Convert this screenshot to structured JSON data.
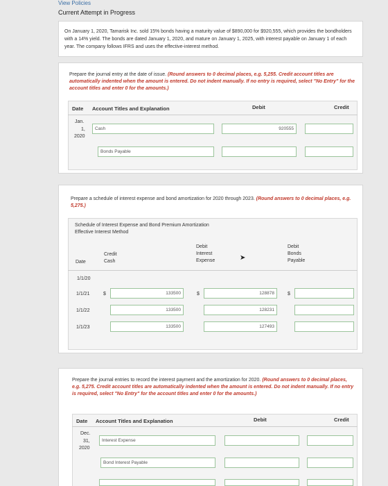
{
  "header": {
    "view_policies": "View Policies",
    "attempt": "Current Attempt in Progress"
  },
  "problem_text": "On January 1, 2020, Tamarisk Inc. sold 15% bonds having a maturity value of $890,000 for $920,555, which provides the bondholders with a 14% yield. The bonds are dated January 1, 2020, and mature on January 1, 2025, with interest payable on January 1 of each year. The company follows IFRS and uses the effective-interest method.",
  "part1": {
    "instruction_plain": "Prepare the journal entry at the date of issue.",
    "instruction_red": "(Round answers to 0 decimal places, e.g. 5,255. Credit account titles are automatically indented when the amount is entered. Do not indent manually. If no entry is required, select \"No Entry\" for the account titles and enter 0 for the amounts.)",
    "columns": {
      "date": "Date",
      "account": "Account Titles and Explanation",
      "debit": "Debit",
      "credit": "Credit"
    },
    "date_month": "Jan.",
    "date_day": "1,",
    "date_year": "2020",
    "rows": [
      {
        "account": "Cash",
        "debit": "920555",
        "credit": ""
      },
      {
        "account": "Bonds Payable",
        "debit": "",
        "credit": ""
      }
    ]
  },
  "part2": {
    "instruction_plain": "Prepare a schedule of interest expense and bond amortization for 2020 through 2023.",
    "instruction_red": "(Round answers to 0 decimal places, e.g. 5,275.)",
    "schedule_title": "Schedule of Interest Expense and Bond Premium Amortization",
    "schedule_subtitle": "Effective Interest Method",
    "columns": {
      "date": "Date",
      "credit_cash": "Credit\nCash",
      "debit_interest": "Debit\nInterest\nExpense",
      "debit_bonds": "Debit\nBonds\nPayable"
    },
    "currency": "$",
    "rows": [
      {
        "date": "1/1/20",
        "cash": "",
        "interest": "",
        "bonds": ""
      },
      {
        "date": "1/1/21",
        "cash": "133500",
        "interest": "128878",
        "bonds": ""
      },
      {
        "date": "1/1/22",
        "cash": "133500",
        "interest": "128231",
        "bonds": ""
      },
      {
        "date": "1/1/23",
        "cash": "133500",
        "interest": "127493",
        "bonds": ""
      }
    ]
  },
  "part3": {
    "instruction_plain": "Prepare the journal entries to record the interest payment and the amortization for 2020.",
    "instruction_red": "(Round answers to 0 decimal places, e.g. 5,275. Credit account titles are automatically indented when the amount is entered. Do not indent manually. If no entry is required, select \"No Entry\" for the account titles and enter 0 for the amounts.)",
    "columns": {
      "date": "Date",
      "account": "Account Titles and Explanation",
      "debit": "Debit",
      "credit": "Credit"
    },
    "date_month": "Dec.",
    "date_day": "31,",
    "date_year": "2020",
    "rows": [
      {
        "account": "Interest Expense",
        "debit": "",
        "credit": ""
      },
      {
        "account": "Bond Interest Payable",
        "debit": "",
        "credit": ""
      }
    ]
  }
}
